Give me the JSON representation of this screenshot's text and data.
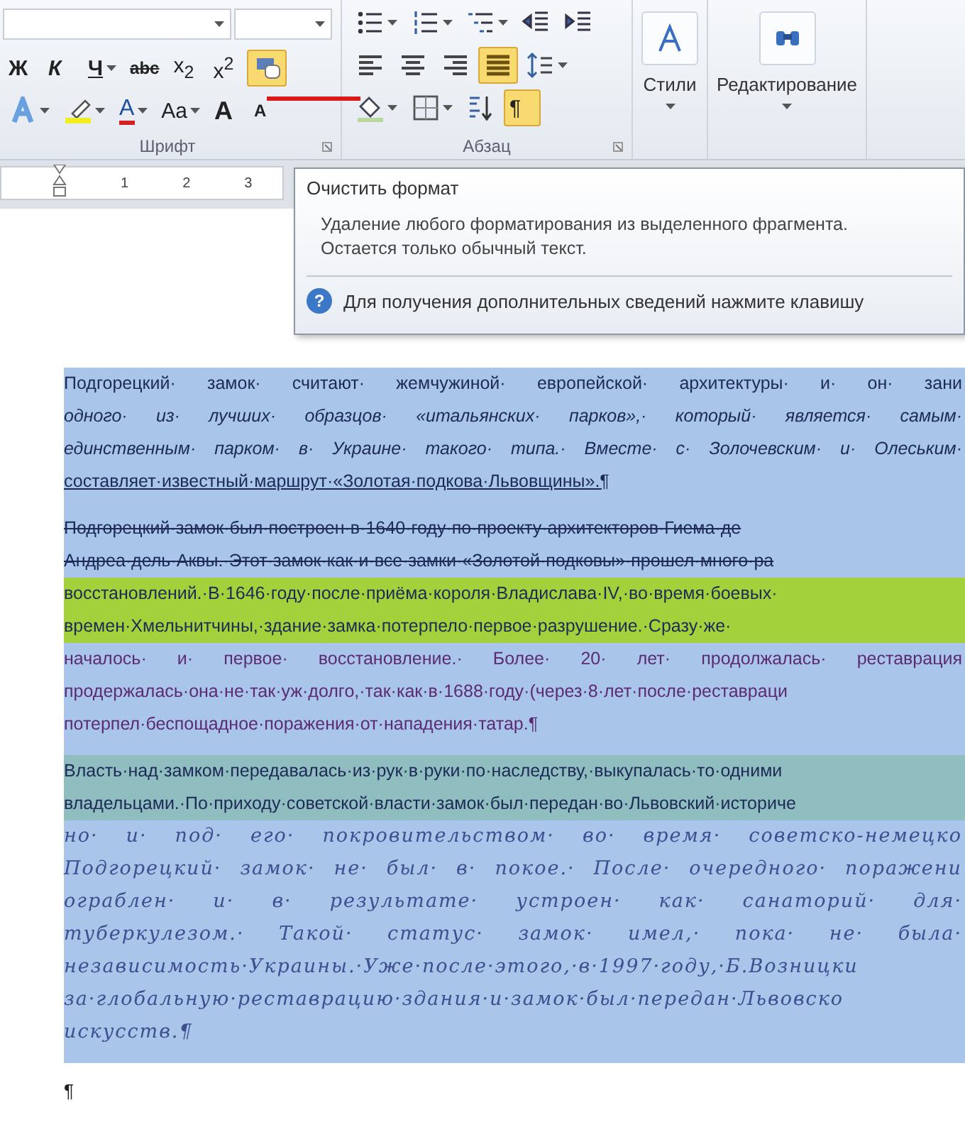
{
  "ribbon": {
    "font": {
      "label": "Шрифт",
      "annotation_stroke": true,
      "toolbar_rows": [
        {
          "buttons": [
            {
              "kind": "text",
              "text": "Ж",
              "selected": false,
              "dropdown": false
            },
            {
              "kind": "text",
              "text": "К",
              "selected": false,
              "dropdown": false
            },
            {
              "kind": "text",
              "text": "Ч",
              "selected": false,
              "dropdown": true
            },
            {
              "kind": "text",
              "text": "abc",
              "selected": false,
              "dropdown": false
            },
            {
              "kind": "text",
              "text": "x$_{2}$",
              "selected": false,
              "dropdown": false
            },
            {
              "kind": "text",
              "text": "x$^{2}$",
              "selected": false,
              "dropdown": false
            },
            {
              "kind": "icon",
              "selected": true,
              "dropdown": false
            }
          ]
        },
        {
          "buttons": [
            {
              "kind": "icon",
              "selected": false,
              "dropdown": true
            },
            {
              "kind": "icon",
              "selected": false,
              "dropdown": true
            },
            {
              "kind": "text",
              "text": "A",
              "selected": false,
              "dropdown": true
            },
            {
              "kind": "text",
              "text": "Aa",
              "selected": false,
              "dropdown": true
            },
            {
              "kind": "text",
              "text": "A",
              "selected": false,
              "dropdown": false
            },
            {
              "kind": "text",
              "text": "A",
              "selected": false,
              "dropdown": false
            }
          ]
        }
      ]
    },
    "paragraph": {
      "label": "Абзац",
      "toolbar_rows": [
        {
          "buttons": [
            {
              "kind": "icon",
              "selected": false,
              "dropdown": true
            },
            {
              "kind": "icon",
              "selected": false,
              "dropdown": true
            },
            {
              "kind": "icon",
              "selected": false,
              "dropdown": true
            },
            {
              "kind": "icon",
              "selected": false,
              "dropdown": false
            },
            {
              "kind": "icon",
              "selected": false,
              "dropdown": false
            }
          ]
        },
        {
          "buttons": [
            {
              "kind": "icon",
              "selected": false,
              "dropdown": false
            },
            {
              "kind": "icon",
              "selected": false,
              "dropdown": false
            },
            {
              "kind": "icon",
              "selected": false,
              "dropdown": false
            },
            {
              "kind": "icon",
              "selected": true,
              "dropdown": false
            },
            {
              "kind": "icon",
              "selected": false,
              "dropdown": true
            }
          ]
        },
        {
          "buttons": [
            {
              "kind": "icon",
              "selected": false,
              "dropdown": true
            },
            {
              "kind": "icon",
              "selected": false,
              "dropdown": true
            },
            {
              "kind": "icon",
              "selected": false,
              "dropdown": false
            },
            {
              "kind": "text",
              "text": "¶",
              "selected": true,
              "dropdown": false
            }
          ]
        }
      ]
    },
    "styles": {
      "label": "Стили"
    },
    "editing": {
      "label": "Редактирование"
    }
  },
  "ruler": {
    "numbers": [
      "1",
      "2",
      "3"
    ]
  },
  "tooltip": {
    "title": "Очистить формат",
    "description": [
      "Удаление любого форматирования из выделенного фрагмента.",
      "Остается только обычный текст."
    ],
    "help_glyph": "?",
    "help": "Для получения дополнительных сведений нажмите клавишу"
  },
  "document": {
    "paragraphs": [
      {
        "lines": [
          {
            "text": "Подгорецкий· замок· считают· жемчужиной· европейской· архитектуры· и· он· зани",
            "kind": "regular"
          },
          {
            "text": "одного· из· лучших· образцов· «итальянских· парков»,· который· является· самым·",
            "kind": "italic"
          },
          {
            "text": "единственным· парком· в· Украине· такого· типа.· Вместе· с· Золочевским· и· Олеським·",
            "kind": "italic"
          },
          {
            "text": "составляет·известный·маршрут·«Золотая·подкова·Львовщины».¶",
            "kind": "underlined",
            "end": true
          }
        ]
      },
      {
        "lines": [
          {
            "text": "Подгорецкий·замок·был·построен·в·1640·году·по·проекту·архитекторов·Гиема·де",
            "kind": "struck"
          },
          {
            "text": "Андреа·дель·Аквы.·Этот·замок·как·и·все·замки·«Золотой·подковы»·прошел·много·ра",
            "kind": "struck"
          },
          {
            "text": "восстановлений.·В·1646·году·после·приёма·короля·Владислава·IV,·во·время·боевых·",
            "kind": "highlighted"
          },
          {
            "text": "времен·Хмельнитчины,·здание·замка·потерпело·первое·разрушение.·Сразу·же·",
            "kind": "highlighted"
          },
          {
            "text": "началось· и· первое· восстановление.· Более· 20· лет· продолжалась· реставрация",
            "kind": "tinted"
          },
          {
            "text": "продержалась·она·не·так·уж·долго,·так·как·в·1688·году·(через·8·лет·после·реставраци",
            "kind": "tinted"
          },
          {
            "text": "потерпел·беспощадное·поражения·от·нападения·татар.¶",
            "kind": "tinted",
            "end": true
          }
        ]
      },
      {
        "lines": [
          {
            "text": "Власть·над·замком·передавалась·из·рук·в·руки·по·наследству,·выкупалась·то·одними",
            "kind": "shaded"
          },
          {
            "text": "владельцами.·По·приходу·советской·власти·замок·был·передан·во·Львовский·историче",
            "kind": "shaded"
          },
          {
            "text": "но· и· под· его· покровительством· во· время· советско-немецко",
            "kind": "serif"
          },
          {
            "text": "Подгорецкий· замок· не· был· в· покое.· После· очередного· поражени",
            "kind": "serif"
          },
          {
            "text": "ограблен· и· в· результате· устроен· как· санаторий· для·",
            "kind": "serif"
          },
          {
            "text": "туберкулезом.· Такой· статус· замок· имел,· пока· не· была·",
            "kind": "serif"
          },
          {
            "text": "независимость·Украины.·Уже·после·этого,·в·1997·году,·Б.Возницки",
            "kind": "serif"
          },
          {
            "text": "за·глобальную·реставрацию·здания·и·замок·был·передан·Львовско",
            "kind": "serif"
          },
          {
            "text": "искусств.¶",
            "kind": "serif",
            "end": true
          }
        ]
      }
    ],
    "trailing_mark": "¶"
  }
}
